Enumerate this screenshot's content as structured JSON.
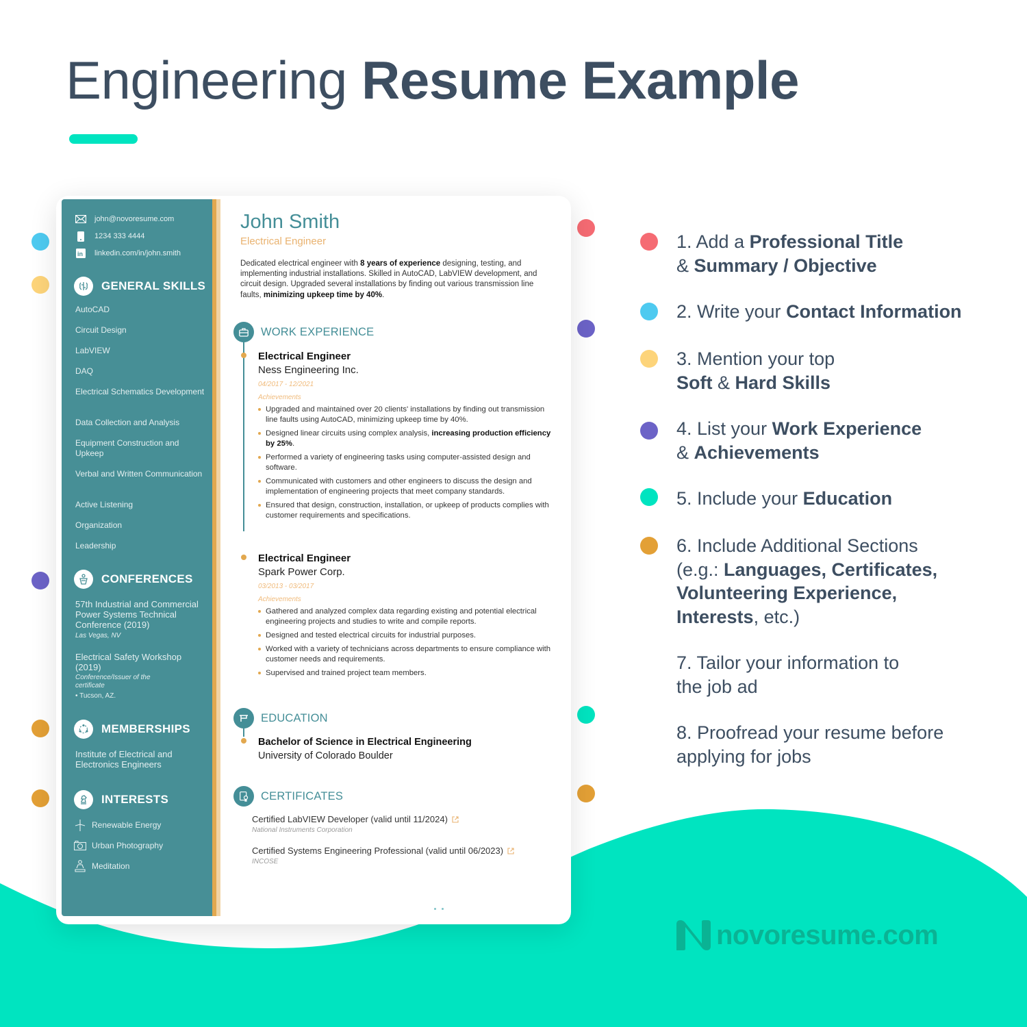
{
  "header": {
    "title_light": "Engineering",
    "title_bold": "Resume Example"
  },
  "colors": {
    "accent": "#00e4c0",
    "teal_sidebar": "#478f96",
    "heading_teal": "#448e97",
    "orange": "#e2a84f",
    "text_dark": "#3d4e61",
    "dot_red": "#f56b73",
    "dot_blue": "#4ecaf0",
    "dot_yellow": "#fdd47a",
    "dot_purple": "#6c63c7",
    "dot_teal": "#00e4c0",
    "dot_orange": "#e3a036"
  },
  "resume": {
    "name": "John Smith",
    "role": "Electrical Engineer",
    "contact": {
      "email": "john@novoresume.com",
      "phone": "1234 333 4444",
      "linkedin": "linkedin.com/in/john.smith"
    },
    "summary": {
      "p1": "Dedicated electrical engineer with ",
      "b1": "8 years of experience",
      "p2": " designing, testing, and implementing industrial installations. Skilled in AutoCAD, LabVIEW development, and circuit design. Upgraded several installations by finding out various transmission line faults, ",
      "b2": "minimizing upkeep time by 40%",
      "p3": "."
    },
    "sidebar": {
      "skills_heading": "GENERAL SKILLS",
      "skills": [
        "AutoCAD",
        "Circuit Design",
        "LabVIEW",
        "DAQ",
        "Electrical Schematics Development",
        "Data Collection and Analysis",
        "Equipment Construction and Upkeep",
        "Verbal and Written Communication",
        "Active Listening",
        "Organization",
        "Leadership"
      ],
      "conferences_heading": "CONFERENCES",
      "conferences": [
        {
          "title": "57th Industrial and Commercial Power Systems Technical Conference (2019)",
          "sub": "Las Vegas, NV"
        },
        {
          "title": "Electrical Safety Workshop (2019)",
          "sub": "Conference/Issuer of the certificate",
          "location": "Tucson, AZ."
        }
      ],
      "memberships_heading": "MEMBERSHIPS",
      "memberships": [
        "Institute of Electrical and Electronics Engineers"
      ],
      "interests_heading": "INTERESTS",
      "interests": [
        {
          "label": "Renewable Energy",
          "icon": "wind-turbine-icon"
        },
        {
          "label": "Urban Photography",
          "icon": "camera-icon"
        },
        {
          "label": "Meditation",
          "icon": "meditation-icon"
        }
      ]
    },
    "work_heading": "WORK EXPERIENCE",
    "jobs": [
      {
        "title": "Electrical Engineer",
        "company": "Ness Engineering Inc.",
        "dates": "04/2017 - 12/2021",
        "achievements_label": "Achievements",
        "bullets": [
          {
            "text": "Upgraded and maintained over 20 clients' installations by finding out transmission line faults using AutoCAD, minimizing upkeep time by 40%."
          },
          {
            "text": "Designed linear circuits using complex analysis, ",
            "bold": "increasing production efficiency by 25%",
            "tail": "."
          },
          {
            "text": "Performed a variety of engineering tasks using computer-assisted design and software."
          },
          {
            "text": "Communicated with customers and other engineers to discuss the design and implementation of engineering projects that meet company standards."
          },
          {
            "text": "Ensured that design, construction, installation, or upkeep of products complies with customer requirements and specifications."
          }
        ]
      },
      {
        "title": "Electrical Engineer",
        "company": "Spark Power Corp.",
        "dates": "03/2013 - 03/2017",
        "achievements_label": "Achievements",
        "bullets": [
          {
            "text": "Gathered and analyzed complex data regarding existing and potential electrical engineering projects and studies to write and compile reports."
          },
          {
            "text": "Designed and tested electrical circuits for industrial purposes."
          },
          {
            "text": "Worked with a variety of technicians across departments to ensure compliance with customer needs and requirements."
          },
          {
            "text": "Supervised and trained project team members."
          }
        ]
      }
    ],
    "education_heading": "EDUCATION",
    "education": {
      "degree": "Bachelor of Science in Electrical Engineering",
      "school": "University of Colorado Boulder"
    },
    "certificates_heading": "CERTIFICATES",
    "certificates": [
      {
        "name": "Certified LabVIEW Developer (valid until 11/2024)",
        "org": "National Instruments Corporation"
      },
      {
        "name": "Certified Systems Engineering Professional (valid until 06/2023)",
        "org": "INCOSE"
      }
    ]
  },
  "steps": [
    {
      "parts": [
        [
          "1. Add a ",
          false
        ],
        [
          "Professional Title",
          true
        ],
        [
          "\n& ",
          false
        ],
        [
          "Summary / Objective",
          true
        ]
      ],
      "color": "#f56b73"
    },
    {
      "parts": [
        [
          "2. Write your ",
          false
        ],
        [
          "Contact Information",
          true
        ]
      ],
      "color": "#4ecaf0"
    },
    {
      "parts": [
        [
          "3. Mention your top\n",
          false
        ],
        [
          "Soft",
          true
        ],
        [
          " & ",
          false
        ],
        [
          "Hard Skills",
          true
        ]
      ],
      "color": "#fdd47a"
    },
    {
      "parts": [
        [
          "4. List your ",
          false
        ],
        [
          "Work Experience",
          true
        ],
        [
          "\n& ",
          false
        ],
        [
          "Achievements",
          true
        ]
      ],
      "color": "#6c63c7"
    },
    {
      "parts": [
        [
          "5. Include your ",
          false
        ],
        [
          "Education",
          true
        ]
      ],
      "color": "#00e4c0"
    },
    {
      "parts": [
        [
          "6. Include Additional Sections\n(e.g.: ",
          false
        ],
        [
          "Languages, Certificates,\nVolunteering Experience,\nInterests",
          true
        ],
        [
          ", etc.)",
          false
        ]
      ],
      "color": "#e3a036"
    },
    {
      "parts": [
        [
          "7. Tailor your information to\nthe job ad",
          false
        ]
      ],
      "color": null
    },
    {
      "parts": [
        [
          "8. Proofread your resume before\napplying for jobs",
          false
        ]
      ],
      "color": null
    }
  ],
  "brand": {
    "wordmark": "novoresume.com"
  }
}
